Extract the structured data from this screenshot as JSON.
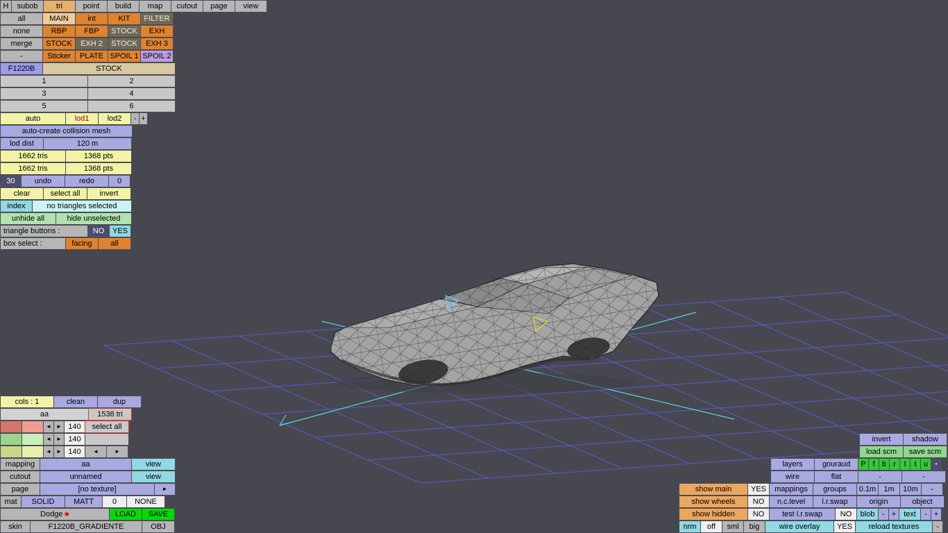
{
  "colors": {
    "viewport_bg": "#47474f",
    "grid": "#5a5ad0",
    "axis": "#55d8d8",
    "accent_orange": "#e0832f",
    "accent_lavender": "#a9a9e2",
    "accent_cyan": "#90d9e5",
    "accent_yellow": "#f3f3a8",
    "accent_green": "#06da06",
    "selection_yellow": "#e6de2e",
    "selection_cyan": "#8ecdf0"
  },
  "menubar": [
    "H",
    "subob",
    "tri",
    "point",
    "build",
    "map",
    "cutout",
    "page",
    "view"
  ],
  "sub": {
    "r1": [
      "all",
      "MAIN",
      "int",
      "KIT",
      "FILTER"
    ],
    "r2": [
      "none",
      "RBP",
      "FBP",
      "STOCK",
      "EXH"
    ],
    "r3": [
      "merge",
      "STOCK",
      "EXH 2",
      "STOCK",
      "EXH 3"
    ],
    "r4": [
      "-",
      "Sticker",
      "PLATE",
      "SPOIL 1",
      "SPOIL 2"
    ],
    "model": "F1220B",
    "variant": "STOCK",
    "slots": [
      "1",
      "2",
      "3",
      "4",
      "5",
      "6"
    ]
  },
  "lod": {
    "auto": "auto",
    "lod1": "lod1",
    "lod2": "lod2",
    "minus": "-",
    "plus": "+",
    "autocreate": "auto-create collision mesh",
    "dist_label": "lod dist",
    "dist_value": "120 m",
    "stats": [
      [
        "1662 tris",
        "1368 pts"
      ],
      [
        "1662 tris",
        "1368 pts"
      ]
    ]
  },
  "edit": {
    "undo_steps": "30",
    "undo": "undo",
    "redo": "redo",
    "redo_steps": "0",
    "clear": "clear",
    "select_all": "select all",
    "invert": "invert",
    "index": "index",
    "status": "no triangles selected",
    "unhide_all": "unhide all",
    "hide_unselected": "hide unselected",
    "tri_buttons_label": "triangle buttons :",
    "tri_no": "NO",
    "tri_yes": "YES",
    "box_label": "box select :",
    "box_facing": "facing",
    "box_all": "all"
  },
  "colorbox": {
    "cols": "cols : 1",
    "clean": "clean",
    "dup": "dup",
    "name": "aa",
    "tri_count": "1538 tri",
    "select_all": "select all",
    "values": [
      "140",
      "140",
      "140"
    ],
    "prev": "◄",
    "next": "►"
  },
  "matbox": {
    "mapping": "mapping",
    "mapping_value": "aa",
    "mapping_view": "view",
    "cutout": "cutout",
    "cutout_value": "unnamed",
    "cutout_view": "view",
    "page": "page",
    "page_value": "[no texture]",
    "page_next": "►",
    "mat": "mat",
    "solid": "SOLID",
    "matt": "MATT",
    "zero": "0",
    "none": "NONE",
    "model": "Dodge",
    "star": "✱",
    "load": "LOAD",
    "save": "SAVE",
    "skin": "skin",
    "skin_value": "F1220B_GRADIENTE",
    "obj": "OBJ"
  },
  "rpanel": {
    "invert": "invert",
    "shadow": "shadow",
    "load_scm": "load scm",
    "save_scm": "save scm",
    "layers": "layers",
    "gouraud": "gouraud",
    "toggles": [
      "P",
      "f",
      "b",
      "r",
      "l",
      "t",
      "u"
    ],
    "dot": "•",
    "wire": "wire",
    "flat": "flat",
    "wire_dash": "-",
    "flat_dash": "-",
    "show_main": "show main",
    "show_main_val": "YES",
    "mappings": "mappings",
    "groups": "groups",
    "snap": [
      "0.1m",
      "1m",
      "10m",
      "-"
    ],
    "show_wheels": "show wheels",
    "show_wheels_val": "NO",
    "nclevel": "n.c.level",
    "lrswap": "l.r.swap",
    "origin": "origin",
    "object": "object",
    "show_hidden": "show hidden",
    "show_hidden_val": "NO",
    "test_lrswap": "test l.r.swap",
    "test_lrswap_val": "NO",
    "blob": "blob",
    "blob_minus": "-",
    "blob_plus": "+",
    "text": "text",
    "text_minus": "-",
    "text_plus": "+",
    "nrm": "nrm",
    "nrm_off": "off",
    "nrm_sml": "sml",
    "nrm_big": "big",
    "wire_overlay": "wire overlay",
    "wire_overlay_val": "YES",
    "reload_textures": "reload textures",
    "reload_dash": "-"
  }
}
